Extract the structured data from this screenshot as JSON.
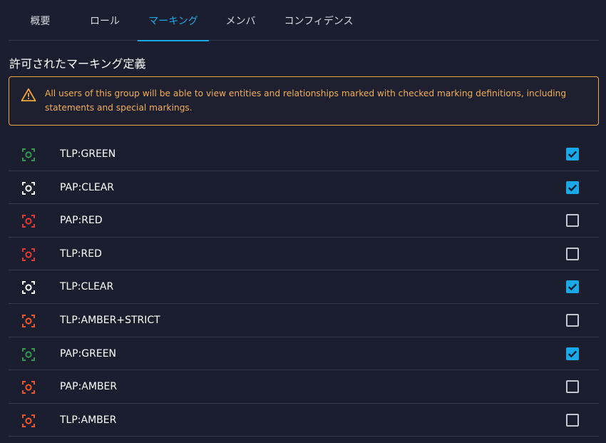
{
  "tabs": [
    {
      "label": "概要",
      "active": false
    },
    {
      "label": "ロール",
      "active": false
    },
    {
      "label": "マーキング",
      "active": true
    },
    {
      "label": "メンバ",
      "active": false
    },
    {
      "label": "コンフィデンス",
      "active": false
    }
  ],
  "section": {
    "title": "許可されたマーキング定義"
  },
  "alert": {
    "icon": "warning-icon",
    "text": "All users of this group will be able to view entities and relationships marked with checked marking definitions, including statements and special markings.",
    "color": "#f0a83c"
  },
  "markings": [
    {
      "label": "TLP:GREEN",
      "color": "#2e9b4e",
      "checked": true
    },
    {
      "label": "PAP:CLEAR",
      "color": "#ffffff",
      "checked": true
    },
    {
      "label": "PAP:RED",
      "color": "#e53935",
      "checked": false
    },
    {
      "label": "TLP:RED",
      "color": "#e53935",
      "checked": false
    },
    {
      "label": "TLP:CLEAR",
      "color": "#ffffff",
      "checked": true
    },
    {
      "label": "TLP:AMBER+STRICT",
      "color": "#f0562a",
      "checked": false
    },
    {
      "label": "PAP:GREEN",
      "color": "#2e9b4e",
      "checked": true
    },
    {
      "label": "PAP:AMBER",
      "color": "#f0562a",
      "checked": false
    },
    {
      "label": "TLP:AMBER",
      "color": "#f0562a",
      "checked": false
    }
  ],
  "colors": {
    "accent": "#1aa8e6",
    "background": "#1b1e2e",
    "divider": "#363a4e"
  }
}
